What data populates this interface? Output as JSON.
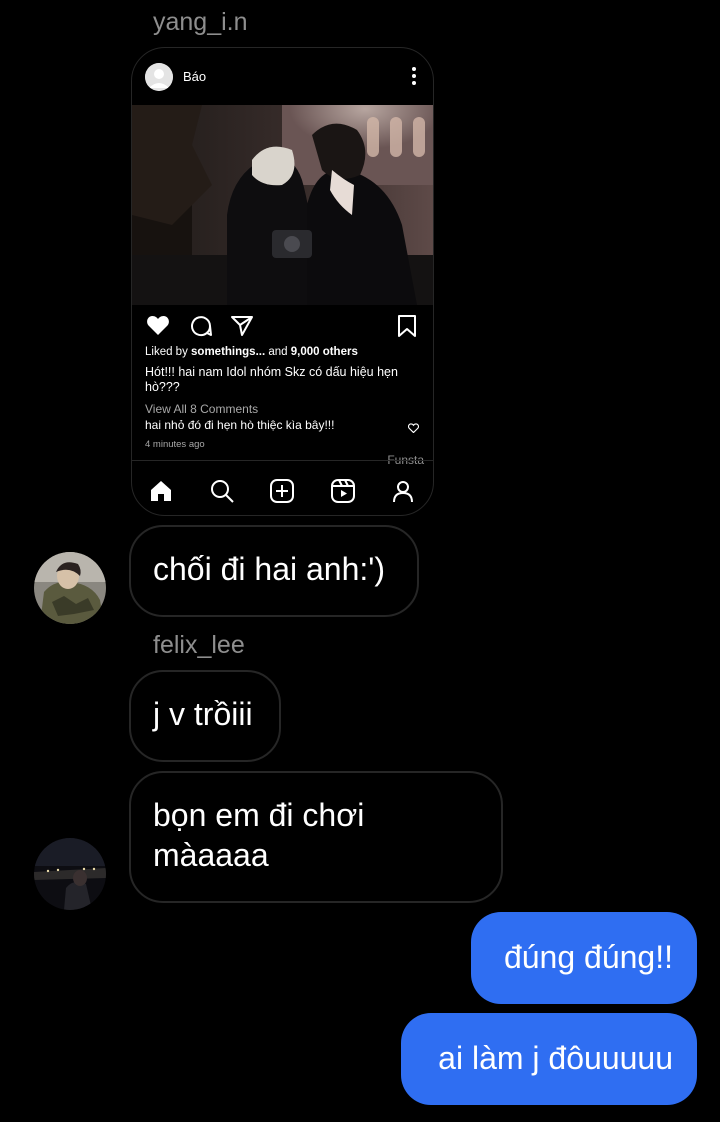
{
  "thread": {
    "sender1": "yang_i.n",
    "sender2": "felix_lee"
  },
  "post": {
    "username": "Báo",
    "likes_prefix": "Liked by ",
    "likes_user": "somethings...",
    "likes_and": " and ",
    "likes_others": "9,000 others",
    "caption_line1": "Hót!!! hai nam Idol nhóm Skz có dấu hiệu hẹn",
    "caption_line2": "hò???",
    "view_comments": "View All 8 Comments",
    "comment": "hai nhỏ đó đi hẹn hò thiệc kìa bây!!!",
    "time": "4 minutes ago",
    "app_watermark": "Funsta"
  },
  "messages": {
    "m1": "chối đi hai anh:')",
    "m2": "j v trồiii",
    "m3_line1": "bọn em đi chơi",
    "m3_line2": "màaaaa",
    "m4": "đúng đúng!!",
    "m5": "ai làm j đôuuuuu"
  },
  "colors": {
    "background": "#000000",
    "outgoing_bubble": "#2f6ef2",
    "bubble_border": "#262626",
    "sender_name": "#8e8e8e"
  }
}
